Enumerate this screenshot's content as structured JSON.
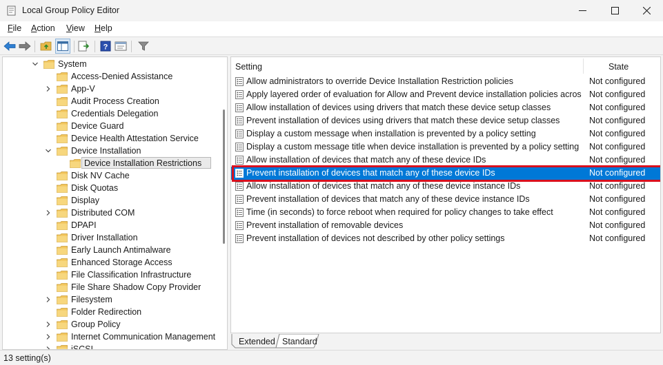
{
  "window": {
    "title": "Local Group Policy Editor",
    "controls": [
      "minimize-icon",
      "maximize-icon",
      "close-icon"
    ]
  },
  "menu": [
    {
      "accel": "F",
      "rest": "ile"
    },
    {
      "accel": "A",
      "rest": "ction"
    },
    {
      "accel": "V",
      "rest": "iew"
    },
    {
      "accel": "H",
      "rest": "elp"
    }
  ],
  "toolbar": {
    "icons": [
      "back-arrow-icon",
      "forward-arrow-icon",
      "up-folder-icon",
      "show-hide-tree-icon",
      "export-list-icon",
      "help-icon",
      "properties-icon",
      "filter-icon"
    ]
  },
  "tree": {
    "items": [
      {
        "label": "System",
        "expander": "expanded"
      },
      {
        "label": "Access-Denied Assistance",
        "expander": "none"
      },
      {
        "label": "App-V",
        "expander": "collapsed"
      },
      {
        "label": "Audit Process Creation",
        "expander": "none"
      },
      {
        "label": "Credentials Delegation",
        "expander": "none"
      },
      {
        "label": "Device Guard",
        "expander": "none"
      },
      {
        "label": "Device Health Attestation Service",
        "expander": "none"
      },
      {
        "label": "Device Installation",
        "expander": "expanded"
      },
      {
        "label": "Device Installation Restrictions",
        "expander": "none",
        "selected": true
      },
      {
        "label": "Disk NV Cache",
        "expander": "none"
      },
      {
        "label": "Disk Quotas",
        "expander": "none"
      },
      {
        "label": "Display",
        "expander": "none"
      },
      {
        "label": "Distributed COM",
        "expander": "collapsed"
      },
      {
        "label": "DPAPI",
        "expander": "none"
      },
      {
        "label": "Driver Installation",
        "expander": "none"
      },
      {
        "label": "Early Launch Antimalware",
        "expander": "none"
      },
      {
        "label": "Enhanced Storage Access",
        "expander": "none"
      },
      {
        "label": "File Classification Infrastructure",
        "expander": "none"
      },
      {
        "label": "File Share Shadow Copy Provider",
        "expander": "none"
      },
      {
        "label": "Filesystem",
        "expander": "collapsed"
      },
      {
        "label": "Folder Redirection",
        "expander": "none"
      },
      {
        "label": "Group Policy",
        "expander": "collapsed"
      },
      {
        "label": "Internet Communication Management",
        "expander": "collapsed"
      },
      {
        "label": "iSCSI",
        "expander": "collapsed"
      }
    ]
  },
  "list": {
    "columns": {
      "setting": "Setting",
      "state": "State"
    },
    "rows": [
      {
        "name": "Allow administrators to override Device Installation Restriction policies",
        "state": "Not configured"
      },
      {
        "name": "Apply layered order of evaluation for Allow and Prevent device installation policies across ...",
        "state": "Not configured"
      },
      {
        "name": "Allow installation of devices using drivers that match these device setup classes",
        "state": "Not configured"
      },
      {
        "name": "Prevent installation of devices using drivers that match these device setup classes",
        "state": "Not configured"
      },
      {
        "name": "Display a custom message when installation is prevented by a policy setting",
        "state": "Not configured"
      },
      {
        "name": "Display a custom message title when device installation is prevented by a policy setting",
        "state": "Not configured"
      },
      {
        "name": "Allow installation of devices that match any of these device IDs",
        "state": "Not configured"
      },
      {
        "name": "Prevent installation of devices that match any of these device IDs",
        "state": "Not configured",
        "selected": true
      },
      {
        "name": "Allow installation of devices that match any of these device instance IDs",
        "state": "Not configured"
      },
      {
        "name": "Prevent installation of devices that match any of these device instance IDs",
        "state": "Not configured"
      },
      {
        "name": "Time (in seconds) to force reboot when required for policy changes to take effect",
        "state": "Not configured"
      },
      {
        "name": "Prevent installation of removable devices",
        "state": "Not configured"
      },
      {
        "name": "Prevent installation of devices not described by other policy settings",
        "state": "Not configured"
      }
    ]
  },
  "tabs": [
    {
      "label": "Extended",
      "active": false
    },
    {
      "label": "Standard",
      "active": true
    }
  ],
  "status": {
    "text": "13 setting(s)"
  },
  "colors": {
    "selection": "#0078d7",
    "highlight_border": "#d9101e",
    "folder": "#f2c55c"
  }
}
